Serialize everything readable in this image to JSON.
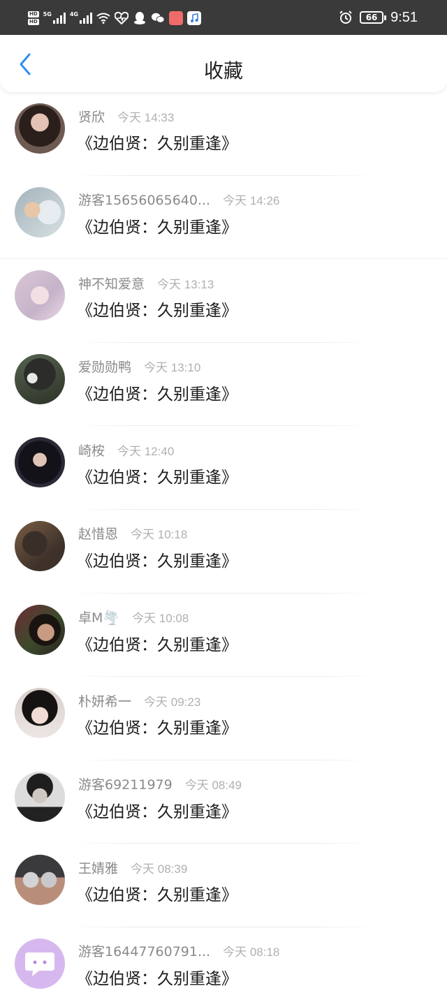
{
  "status_bar": {
    "hd_labels": [
      "HD",
      "HD"
    ],
    "network_5g": "5G",
    "network_4g": "4G",
    "battery_level": "66",
    "time": "9:51"
  },
  "header": {
    "title": "收藏",
    "back_icon": "chevron-left-icon"
  },
  "colors": {
    "accent": "#2f8ff0",
    "status_bar_bg": "#3a3a3a",
    "name_text": "#8a8a8a",
    "time_text": "#b0b0b0"
  },
  "favorites": [
    {
      "name": "贤欣",
      "time": "今天 14:33",
      "content": "《边伯贤：久别重逢》"
    },
    {
      "name": "游客15656065640...",
      "time": "今天 14:26",
      "content": "《边伯贤：久别重逢》"
    },
    {
      "name": "神不知爱意",
      "time": "今天 13:13",
      "content": "《边伯贤：久别重逢》"
    },
    {
      "name": "爱勋勋鸭",
      "time": "今天 13:10",
      "content": "《边伯贤：久别重逢》"
    },
    {
      "name": "崎桉",
      "time": "今天 12:40",
      "content": "《边伯贤：久别重逢》"
    },
    {
      "name": "赵惜恩",
      "time": "今天 10:18",
      "content": "《边伯贤：久别重逢》"
    },
    {
      "name": "卓M🌪️",
      "time": "今天 10:08",
      "content": "《边伯贤：久别重逢》"
    },
    {
      "name": "朴妍希一",
      "time": "今天 09:23",
      "content": "《边伯贤：久别重逢》"
    },
    {
      "name": "游客69211979",
      "time": "今天 08:49",
      "content": "《边伯贤：久别重逢》"
    },
    {
      "name": "王婧雅",
      "time": "今天 08:39",
      "content": "《边伯贤：久别重逢》"
    },
    {
      "name": "游客16447760791...",
      "time": "今天 08:18",
      "content": "《边伯贤：久别重逢》"
    }
  ]
}
